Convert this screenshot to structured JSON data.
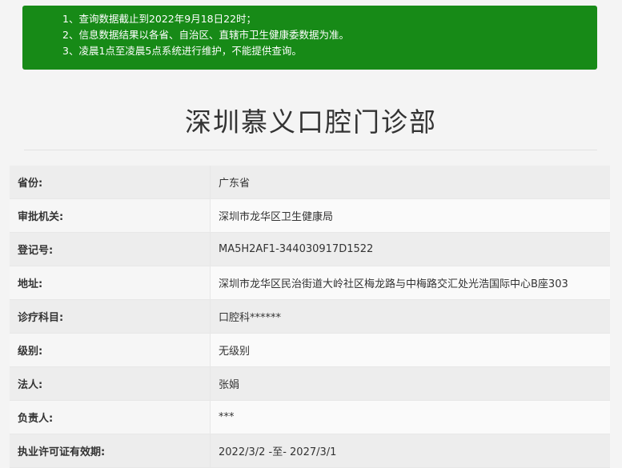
{
  "notice": {
    "lines": [
      "1、查询数据截止到2022年9月18日22时；",
      "2、信息数据结果以各省、自治区、直辖市卫生健康委数据为准。",
      "3、凌晨1点至凌晨5点系统进行维护，不能提供查询。"
    ],
    "background": "#178a17"
  },
  "title": "深圳慕义口腔门诊部",
  "rows": [
    {
      "label": "省份:",
      "value": "广东省"
    },
    {
      "label": "审批机关:",
      "value": "深圳市龙华区卫生健康局"
    },
    {
      "label": "登记号:",
      "value": "MA5H2AF1-344030917D1522"
    },
    {
      "label": "地址:",
      "value": "深圳市龙华区民治街道大岭社区梅龙路与中梅路交汇处光浩国际中心B座303"
    },
    {
      "label": "诊疗科目:",
      "value": "口腔科******"
    },
    {
      "label": "级别:",
      "value": "无级别"
    },
    {
      "label": "法人:",
      "value": "张娟"
    },
    {
      "label": "负责人:",
      "value": "***"
    },
    {
      "label": "执业许可证有效期:",
      "value": "2022/3/2 -至- 2027/3/1"
    }
  ]
}
